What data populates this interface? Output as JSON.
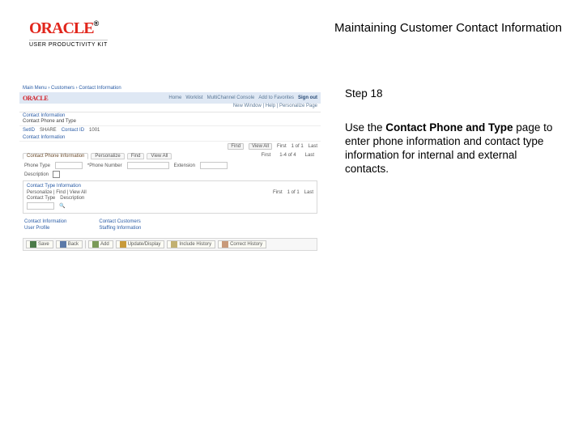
{
  "header": {
    "brand": "ORACLE",
    "brand_suffix": "®",
    "tagline": "USER PRODUCTIVITY KIT",
    "title": "Maintaining Customer Contact Information"
  },
  "step": {
    "label": "Step 18"
  },
  "body": {
    "pre": "Use the ",
    "bold": "Contact Phone and Type",
    "post": " page to enter phone information and contact type information for internal and external contacts."
  },
  "shot": {
    "brand": "ORACLE",
    "crumb": "Main Menu › Customers › Contact Information",
    "nav": [
      "Home",
      "Worklist",
      "MultiChannel Console",
      "Add to Favorites",
      "Sign out"
    ],
    "nav_on_index": 4,
    "subnav": "New Window | Help | Personalize Page",
    "sect_title": "Contact Information",
    "page_title": "Contact Phone and Type",
    "setid": {
      "label": "SetID",
      "value": "SHARE"
    },
    "contact_id": {
      "label": "Contact ID",
      "value": "1001"
    },
    "inner_title": "Contact Information",
    "findrow": {
      "find": "Find",
      "viewall": "View All",
      "first": "First",
      "pager": "1 of 1",
      "last": "Last"
    },
    "tabs": [
      "Contact Phone Information",
      "Personalize",
      "Find",
      "View All"
    ],
    "tab2": {
      "first": "First",
      "pager": "1-4 of 4",
      "last": "Last"
    },
    "cols": [
      "Phone Type",
      "*Phone Number",
      "Extension"
    ],
    "desc": "Description",
    "section2_title": "Contact Type Information",
    "section2_sub": "Personalize | Find | View All",
    "s2pager": {
      "first": "First",
      "pager": "1 of 1",
      "last": "Last"
    },
    "grid": {
      "title": "Contact Type",
      "col": "Description"
    },
    "links": {
      "left": [
        "Contact Information",
        "User Profile"
      ],
      "right": [
        "Contact Customers",
        "Staffing Information"
      ]
    },
    "btns": [
      "Save",
      "Back",
      "Add",
      "Update/Display",
      "Include History",
      "Correct History"
    ]
  }
}
